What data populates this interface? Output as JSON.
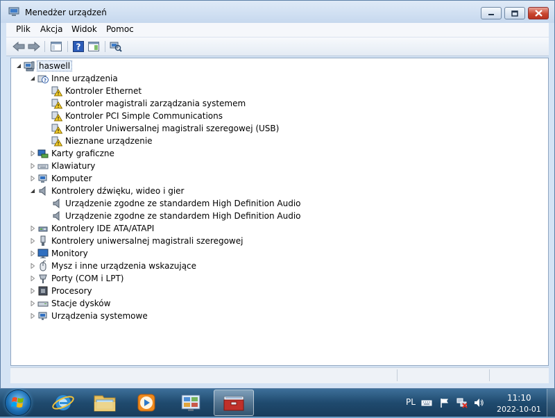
{
  "window": {
    "title": "Menedżer urządzeń",
    "menu": [
      "Plik",
      "Akcja",
      "Widok",
      "Pomoc"
    ]
  },
  "tree": [
    {
      "label": "haswell",
      "level": 0,
      "expanded": true,
      "icon": "computer-icon",
      "selected": true
    },
    {
      "label": "Inne urządzenia",
      "level": 1,
      "expanded": true,
      "icon": "unknown-device-icon"
    },
    {
      "label": "Kontroler Ethernet",
      "level": 2,
      "icon": "warning-device-icon"
    },
    {
      "label": "Kontroler magistrali zarządzania systemem",
      "level": 2,
      "icon": "warning-device-icon"
    },
    {
      "label": "Kontroler PCI Simple Communications",
      "level": 2,
      "icon": "warning-device-icon"
    },
    {
      "label": "Kontroler Uniwersalnej magistrali szeregowej (USB)",
      "level": 2,
      "icon": "warning-device-icon"
    },
    {
      "label": "Nieznane urządzenie",
      "level": 2,
      "icon": "warning-device-icon"
    },
    {
      "label": "Karty graficzne",
      "level": 1,
      "expanded": false,
      "icon": "display-adapter-icon"
    },
    {
      "label": "Klawiatury",
      "level": 1,
      "expanded": false,
      "icon": "keyboard-icon"
    },
    {
      "label": "Komputer",
      "level": 1,
      "expanded": false,
      "icon": "computer-small-icon"
    },
    {
      "label": "Kontrolery dźwięku, wideo i gier",
      "level": 1,
      "expanded": true,
      "icon": "speaker-icon"
    },
    {
      "label": "Urządzenie zgodne ze standardem High Definition Audio",
      "level": 2,
      "icon": "speaker-icon"
    },
    {
      "label": "Urządzenie zgodne ze standardem High Definition Audio",
      "level": 2,
      "icon": "speaker-icon"
    },
    {
      "label": "Kontrolery IDE ATA/ATAPI",
      "level": 1,
      "expanded": false,
      "icon": "ide-controller-icon"
    },
    {
      "label": "Kontrolery uniwersalnej magistrali szeregowej",
      "level": 1,
      "expanded": false,
      "icon": "usb-icon"
    },
    {
      "label": "Monitory",
      "level": 1,
      "expanded": false,
      "icon": "monitor-icon"
    },
    {
      "label": "Mysz i inne urządzenia wskazujące",
      "level": 1,
      "expanded": false,
      "icon": "mouse-icon"
    },
    {
      "label": "Porty (COM i LPT)",
      "level": 1,
      "expanded": false,
      "icon": "port-icon"
    },
    {
      "label": "Procesory",
      "level": 1,
      "expanded": false,
      "icon": "processor-icon"
    },
    {
      "label": "Stacje dysków",
      "level": 1,
      "expanded": false,
      "icon": "disk-drive-icon"
    },
    {
      "label": "Urządzenia systemowe",
      "level": 1,
      "expanded": false,
      "icon": "system-devices-icon"
    }
  ],
  "taskbar": {
    "language": "PL",
    "time": "11:10",
    "date": "2022-10-01"
  }
}
